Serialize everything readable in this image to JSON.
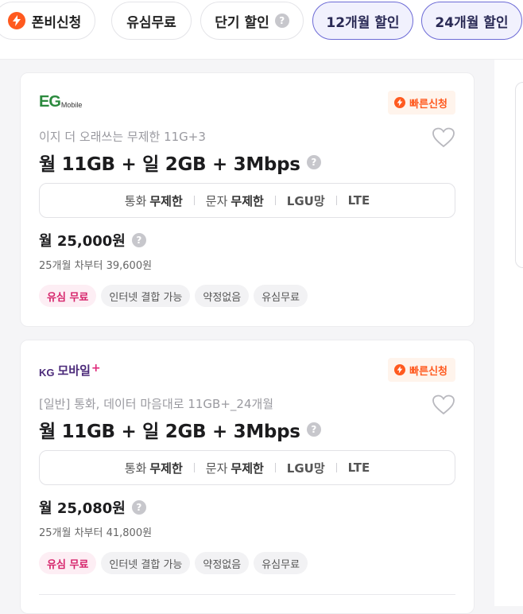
{
  "filters": [
    {
      "label": "폰비신청",
      "icon": "lightning-icon"
    },
    {
      "label": "유심무료"
    },
    {
      "label": "단기 할인",
      "help": "?"
    },
    {
      "label": "12개월 할인",
      "active": true
    },
    {
      "label": "24개월 할인",
      "active": true
    }
  ],
  "colors": {
    "accent": "#6d6bd6",
    "fast": "#ff5a1f",
    "pink": "#d6246b",
    "eg_green": "#2b8a3e",
    "kg_purple": "#4b2a7a"
  },
  "plans": [
    {
      "carrier_logo": {
        "main": "EG",
        "sub": "Mobile"
      },
      "fast_badge": "빠른신청",
      "name": "이지 더 오래쓰는 무제한 11G+3",
      "title": "월 11GB + 일 2GB + 3Mbps",
      "specs": {
        "call_label": "통화",
        "call_value": "무제한",
        "sms_label": "문자",
        "sms_value": "무제한",
        "network": "LGU망",
        "type": "LTE"
      },
      "price": "월 25,000원",
      "price_after": "25개월 차부터 39,600원",
      "tags": [
        "유심 무료",
        "인터넷 결합 가능",
        "약정없음",
        "유심무료"
      ]
    },
    {
      "carrier_logo": {
        "main": "KG",
        "sub": "모바일",
        "mark": "+"
      },
      "fast_badge": "빠른신청",
      "name": "[일반] 통화, 데이터 마음대로 11GB+_24개월",
      "title": "월 11GB + 일 2GB + 3Mbps",
      "specs": {
        "call_label": "통화",
        "call_value": "무제한",
        "sms_label": "문자",
        "sms_value": "무제한",
        "network": "LGU망",
        "type": "LTE"
      },
      "price": "월 25,080원",
      "price_after": "25개월 차부터 41,800원",
      "tags": [
        "유심 무료",
        "인터넷 결합 가능",
        "약정없음",
        "유심무료"
      ]
    }
  ]
}
